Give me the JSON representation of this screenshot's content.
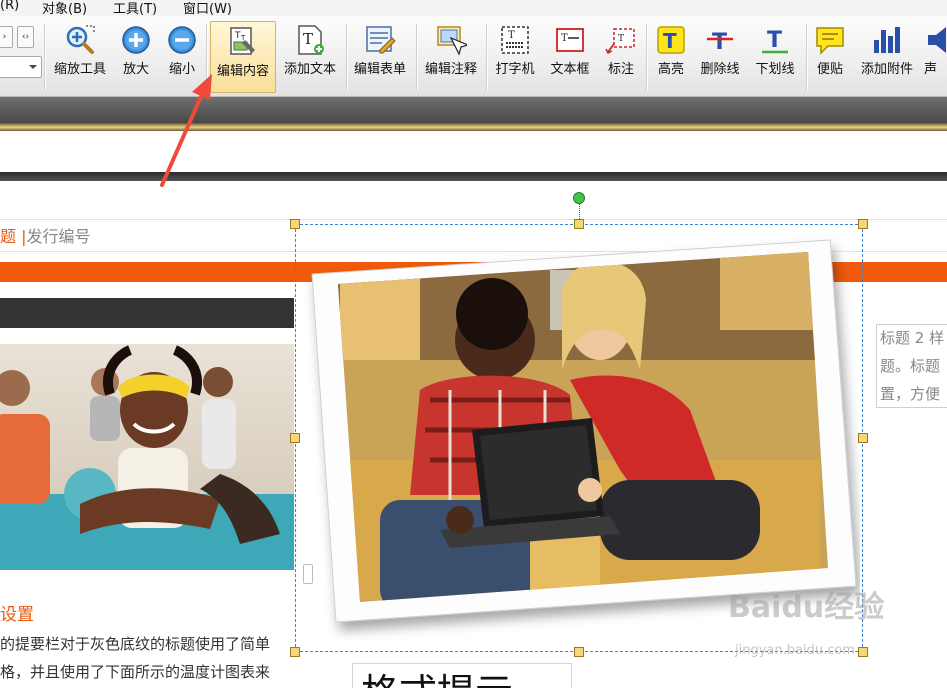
{
  "menu": {
    "items": [
      "(R)",
      "对象(B)",
      "工具(T)",
      "窗口(W)"
    ]
  },
  "toolbar": {
    "buttons": [
      {
        "label": "缩放工具",
        "icon": "zoom-tool-icon"
      },
      {
        "label": "放大",
        "icon": "zoom-in-icon"
      },
      {
        "label": "缩小",
        "icon": "zoom-out-icon"
      },
      {
        "label": "编辑内容",
        "icon": "edit-content-icon"
      },
      {
        "label": "添加文本",
        "icon": "add-text-icon"
      },
      {
        "label": "编辑表单",
        "icon": "edit-form-icon"
      },
      {
        "label": "编辑注释",
        "icon": "edit-annotation-icon"
      },
      {
        "label": "打字机",
        "icon": "typewriter-icon"
      },
      {
        "label": "文本框",
        "icon": "text-box-icon"
      },
      {
        "label": "标注",
        "icon": "callout-icon"
      },
      {
        "label": "高亮",
        "icon": "highlight-icon"
      },
      {
        "label": "删除线",
        "icon": "strikethrough-icon"
      },
      {
        "label": "下划线",
        "icon": "underline-icon"
      },
      {
        "label": "便贴",
        "icon": "sticky-note-icon"
      },
      {
        "label": "添加附件",
        "icon": "attachment-icon"
      },
      {
        "label": "声",
        "icon": "sound-icon"
      }
    ],
    "active_button": "编辑内容"
  },
  "document": {
    "breadcrumb_active": "题",
    "breadcrumb_rest": "发行编号",
    "section_title": "设置",
    "body_lines": [
      "的提要栏对于灰色底纹的标题使用了简单",
      "格，并且使用了下面所示的温度计图表来"
    ],
    "side_lines": [
      "标题 2 样",
      "题。标题",
      "置，方便"
    ],
    "big_heading": "格式提示"
  },
  "watermark": {
    "text": "Baidu经验",
    "sub": "jingyan.baidu.com"
  },
  "colors": {
    "accent_orange": "#f05a0a",
    "selection_blue": "#3a84d8",
    "handle_yellow": "#f7d775",
    "pointer_arrow": "#f04a3a"
  }
}
